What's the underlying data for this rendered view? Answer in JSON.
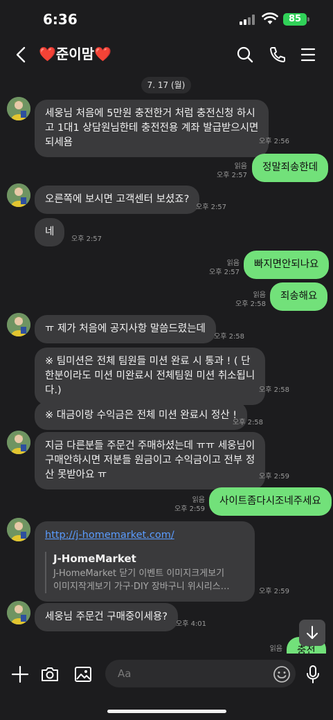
{
  "status_bar": {
    "time": "6:36",
    "battery": "85"
  },
  "header": {
    "heart_left": "❤️",
    "name": "준이맘",
    "heart_right": "❤️"
  },
  "date_divider": "7. 17 (월)",
  "messages": [
    {
      "side": "in",
      "avatar": true,
      "lines": [
        "세웅님 처음에 5만원 충전한거 처럼 충전신청 하시",
        "고 1대1 상담원님한테 충전전용 계좌 발급받으시면",
        "되세욤"
      ],
      "time": "오후 2:56"
    },
    {
      "side": "out",
      "text": "정말죄송한데",
      "read": "읽음",
      "time": "오후 2:57"
    },
    {
      "side": "in",
      "avatar": true,
      "text": "오른쪽에 보시면 고객센터 보셨죠?",
      "time": "오후 2:57"
    },
    {
      "side": "in",
      "avatar": false,
      "text": "네",
      "time": "오후 2:57"
    },
    {
      "side": "out",
      "text": "빠지면안되나요",
      "read": "읽음",
      "time": "오후 2:57"
    },
    {
      "side": "out",
      "text": "죄송해요",
      "read": "읽음",
      "time": "오후 2:58"
    },
    {
      "side": "in",
      "avatar": true,
      "text": "ㅠ 제가 처음에 공지사항 말씀드렸는데",
      "time": "오후 2:58"
    },
    {
      "side": "in",
      "avatar": false,
      "lines": [
        "※ 팀미션은 전체 팀원들 미션 완료 시 통과 ! ( 단",
        "한분이라도 미션 미완료시 전체팀원 미션 취소됩니",
        "다.)"
      ],
      "time": "오후 2:58"
    },
    {
      "side": "in",
      "avatar": false,
      "text": "※ 대금이랑 수익금은 전체 미션 완료시 정산 !",
      "time": "오후 2:58"
    },
    {
      "side": "in",
      "avatar": true,
      "lines": [
        "지금 다른분들 주문건 주매하셨는데 ㅠㅠ 세웅님이",
        "구매안하시면 저분들 원금이고 수익금이고 전부 정",
        "산 못받아요 ㅠ"
      ],
      "time": "오후 2:59"
    },
    {
      "side": "out",
      "text": "사이트좀다시조네주세요",
      "read": "읽음",
      "time": "오후 2:59"
    },
    {
      "side": "in",
      "avatar": true,
      "link": {
        "url": "http://j-homemarket.com/",
        "title": "J-HomeMarket",
        "desc_lines": [
          "J-HomeMarket 닫기 이벤트 이미지크게보기",
          "이미지작게보기 가구·DIY 장바구니 위시리스…"
        ]
      },
      "time": "오후 2:59"
    },
    {
      "side": "in",
      "avatar": true,
      "text": "세웅님 주문건 구매중이세용?",
      "time": "오후 4:01"
    },
    {
      "side": "out",
      "text": "충전",
      "read": "읽음",
      "time": ""
    }
  ],
  "input": {
    "placeholder": "Aa"
  },
  "colors": {
    "outgoing_bubble": "#72e17a",
    "incoming_bubble": "#3a3a3c",
    "background": "#1c1c1e",
    "link": "#5a9cff",
    "battery": "#30d158"
  },
  "icons": [
    "back-icon",
    "search-icon",
    "phone-icon",
    "menu-icon",
    "plus-icon",
    "camera-icon",
    "image-icon",
    "emoji-icon",
    "mic-icon",
    "arrow-down-icon"
  ]
}
